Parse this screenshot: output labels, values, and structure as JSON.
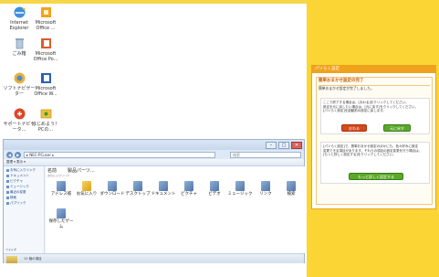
{
  "desktop": {
    "icons": [
      {
        "label": "Internet Explorer",
        "icon": "internet-explorer-icon"
      },
      {
        "label": "Microsoft Office ...",
        "icon": "office-icon"
      },
      {
        "label": "ごみ箱",
        "icon": "recycle-bin-icon"
      },
      {
        "label": "Microsoft Office Po...",
        "icon": "powerpoint-icon"
      },
      {
        "label": "ソフトナビゲーター",
        "icon": "soft-navigator-icon"
      },
      {
        "label": "Microsoft Office W...",
        "icon": "word-icon"
      },
      {
        "label": "サポートナビゲータ...",
        "icon": "support-navigator-icon"
      },
      {
        "label": "はじめよう！PCの...",
        "icon": "getting-started-icon"
      }
    ]
  },
  "dialog": {
    "title": "パソらく設定",
    "heading": "簡単おまかせ設定の完了",
    "subtitle": "簡単おまかせ設定が完了しました。",
    "box1_lines": [
      "ここで終了する場合は、[おわる]をクリックしてください。",
      "設定を元に戻したい場合は、[元に戻す]をクリックしてください。",
      "[パソらく設定]を起動前の設定に戻します。"
    ],
    "end_button": "おわる",
    "revert_button": "元に戻す",
    "box2_lines": [
      "[パソらく設定]で、簡単おまかせ設定のほかにも、色々好みに設定",
      "変更できる項目があります。それらの項目の設定変更を行う場合は、",
      "[もっと詳しく設定する]をクリックしてください。"
    ],
    "detail_button": "もっと詳しく設定する"
  },
  "explorer": {
    "address": "▸ NEC-PCuser ▸",
    "search_placeholder": "検索",
    "toolbar": "整理 ▾   表示 ▾",
    "column_header": "名前",
    "column_header2": "製品パーツ...",
    "sub_label": "お気に入りリンク",
    "nav_items": [
      "お気に入りリンク",
      "ドキュメント",
      "ピクチャ",
      "ミュージック",
      "最近の変更",
      "検索",
      "パブリック"
    ],
    "folders": [
      {
        "label": "アドレス帳"
      },
      {
        "label": "お気に入り"
      },
      {
        "label": "ダウンロード"
      },
      {
        "label": "デスクトップ"
      },
      {
        "label": "ドキュメント"
      },
      {
        "label": "ピクチャ"
      },
      {
        "label": "ビデオ"
      },
      {
        "label": "ミュージック"
      },
      {
        "label": "リンク"
      },
      {
        "label": "検索"
      },
      {
        "label": "保存したゲーム"
      }
    ],
    "status_label": "フォルダ",
    "status_text": "11 個の項目",
    "controls": {
      "min": "–",
      "max": "□",
      "close": "✕"
    }
  },
  "colors": {
    "panel_bg": "#fbd534",
    "dialog_title": "#f0a21c",
    "heading": "#c55a00",
    "end_button": "#d54a1c",
    "revert_button": "#5aa82a"
  }
}
